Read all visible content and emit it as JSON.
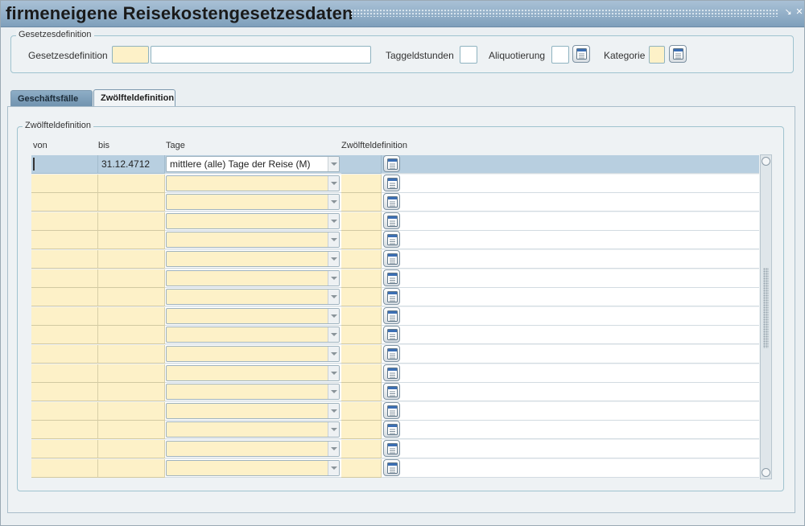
{
  "window": {
    "title": "firmeneigene Reisekostengesetzesdaten",
    "icons": [
      "minimize-icon",
      "close-icon"
    ]
  },
  "header_group": {
    "legend": "Gesetzesdefinition",
    "gesetzesdefinition_label": "Gesetzesdefinition",
    "gesetzesdefinition_code": "",
    "gesetzesdefinition_name": "",
    "taggeldstunden_label": "Taggeldstunden",
    "taggeldstunden_value": "",
    "aliquotierung_label": "Aliquotierung",
    "aliquotierung_value": "",
    "kategorie_label": "Kategorie",
    "kategorie_value": ""
  },
  "tabs": [
    {
      "label": "Geschäftsfälle",
      "active": false
    },
    {
      "label": "Zwölfteldefinition",
      "active": true
    }
  ],
  "grid": {
    "legend": "Zwölfteldefinition",
    "columns": [
      "von",
      "bis",
      "Tage",
      "Zwölfteldefinition"
    ],
    "rows": [
      {
        "von": "",
        "bis": "31.12.4712",
        "tage": "mittlere (alle) Tage der Reise (M)",
        "zwoelftel": ""
      },
      {
        "von": "",
        "bis": "",
        "tage": "",
        "zwoelftel": ""
      },
      {
        "von": "",
        "bis": "",
        "tage": "",
        "zwoelftel": ""
      },
      {
        "von": "",
        "bis": "",
        "tage": "",
        "zwoelftel": ""
      },
      {
        "von": "",
        "bis": "",
        "tage": "",
        "zwoelftel": ""
      },
      {
        "von": "",
        "bis": "",
        "tage": "",
        "zwoelftel": ""
      },
      {
        "von": "",
        "bis": "",
        "tage": "",
        "zwoelftel": ""
      },
      {
        "von": "",
        "bis": "",
        "tage": "",
        "zwoelftel": ""
      },
      {
        "von": "",
        "bis": "",
        "tage": "",
        "zwoelftel": ""
      },
      {
        "von": "",
        "bis": "",
        "tage": "",
        "zwoelftel": ""
      },
      {
        "von": "",
        "bis": "",
        "tage": "",
        "zwoelftel": ""
      },
      {
        "von": "",
        "bis": "",
        "tage": "",
        "zwoelftel": ""
      },
      {
        "von": "",
        "bis": "",
        "tage": "",
        "zwoelftel": ""
      },
      {
        "von": "",
        "bis": "",
        "tage": "",
        "zwoelftel": ""
      },
      {
        "von": "",
        "bis": "",
        "tage": "",
        "zwoelftel": ""
      },
      {
        "von": "",
        "bis": "",
        "tage": "",
        "zwoelftel": ""
      },
      {
        "von": "",
        "bis": "",
        "tage": "",
        "zwoelftel": ""
      }
    ]
  },
  "colors": {
    "titlebar": "#7e9fbb",
    "field_required": "#fdf1c8",
    "current_row": "#b8cfe0"
  }
}
